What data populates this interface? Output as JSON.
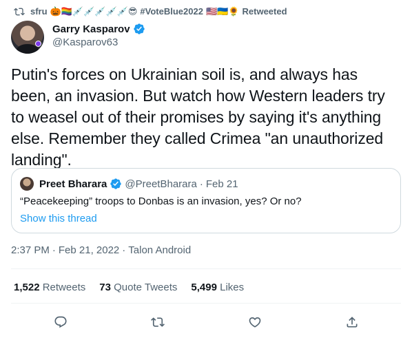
{
  "retweet_header": {
    "icon": "retweet-icon",
    "user": "sfru",
    "emoji": "🎃🏳️‍🌈💉💉💉💉💉😎",
    "hashtag": "#VoteBlue2022",
    "flags": "🇺🇸🇺🇦🌻",
    "suffix": "Retweeted"
  },
  "author": {
    "name": "Garry Kasparov",
    "handle": "@Kasparov63",
    "verified_icon": "verified-badge-icon"
  },
  "tweet": {
    "text": "Putin's forces on Ukrainian soil is, and always has been, an invasion. But watch how Western leaders try to weasel out of their promises by saying it's anything else. Remember they called Crimea \"an unauthorized landing\"."
  },
  "quote": {
    "name": "Preet Bharara",
    "handle": "@PreetBharara",
    "dot": "·",
    "date": "Feb 21",
    "text": "“Peacekeeping” troops to Donbas is an invasion, yes? Or no?",
    "link": "Show this thread"
  },
  "meta": {
    "time": "2:37 PM",
    "dot1": "·",
    "date": "Feb 21, 2022",
    "dot2": "·",
    "source": "Talon Android"
  },
  "stats": {
    "retweets_count": "1,522",
    "retweets_label": "Retweets",
    "quotes_count": "73",
    "quotes_label": "Quote Tweets",
    "likes_count": "5,499",
    "likes_label": "Likes"
  },
  "actions": [
    "reply-icon",
    "retweet-icon",
    "like-icon",
    "share-icon"
  ],
  "colors": {
    "accent": "#1d9bf0",
    "secondary_text": "#536471",
    "border": "#cfd9de"
  }
}
